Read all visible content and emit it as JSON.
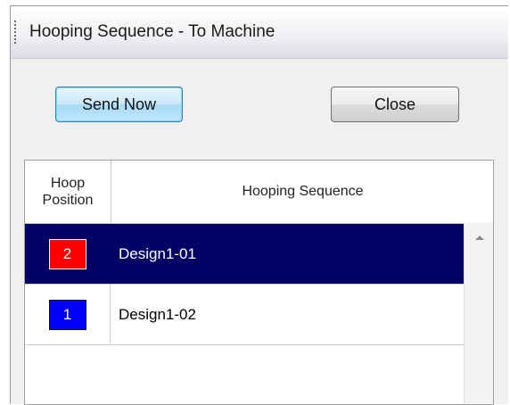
{
  "window": {
    "title": "Hooping Sequence - To Machine"
  },
  "buttons": {
    "send_now": "Send Now",
    "close": "Close"
  },
  "grid": {
    "columns": [
      "Hoop\nPosition",
      "Hooping Sequence"
    ],
    "rows": [
      {
        "hoop_position": "2",
        "hoop_color": "#ff0000",
        "design": "Design1-01",
        "selected": true
      },
      {
        "hoop_position": "1",
        "hoop_color": "#0000ff",
        "design": "Design1-02",
        "selected": false
      }
    ]
  },
  "colors": {
    "selection": "#030264"
  },
  "icons": {
    "scroll_up": "scroll-up-arrow-icon",
    "title_grip": "drag-grip-icon"
  }
}
